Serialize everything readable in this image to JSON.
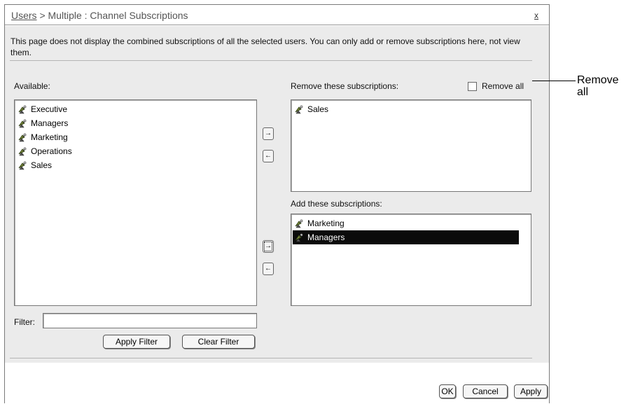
{
  "dialog": {
    "breadcrumb_link": "Users",
    "title_rest": " > Multiple : Channel Subscriptions",
    "close_label": "x",
    "info_text": "This page does not display the combined subscriptions of all the selected users. You can only add or remove subscriptions here, not view them."
  },
  "available": {
    "label": "Available:",
    "items": [
      "Executive",
      "Managers",
      "Marketing",
      "Operations",
      "Sales"
    ]
  },
  "remove": {
    "label": "Remove these subscriptions:",
    "remove_all_label": "Remove all",
    "remove_all_checked": false,
    "items": [
      "Sales"
    ]
  },
  "add": {
    "label": "Add these subscriptions:",
    "items": [
      "Marketing",
      "Managers"
    ],
    "selected_item": "Managers"
  },
  "arrows": {
    "right": "→",
    "left": "←"
  },
  "filter": {
    "label": "Filter:",
    "value": "",
    "apply_label": "Apply Filter",
    "clear_label": "Clear Filter"
  },
  "footer": {
    "ok_label": "OK",
    "cancel_label": "Cancel",
    "apply_label": "Apply"
  },
  "callout": {
    "line1": "Remove",
    "line2": "all"
  },
  "icons": {
    "channel": "satellite-dish-icon",
    "selection_color": "#0b0b0b"
  }
}
